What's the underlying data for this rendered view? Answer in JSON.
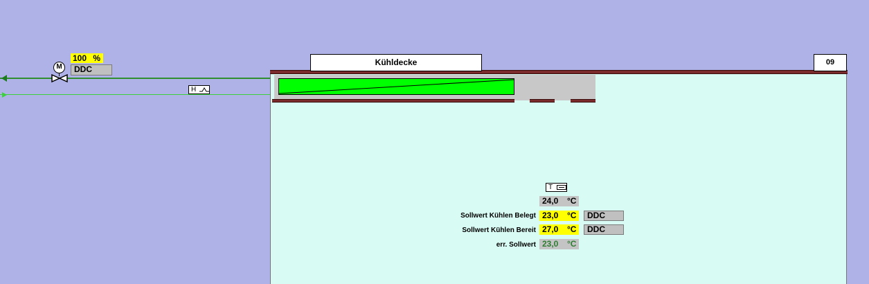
{
  "valve": {
    "motor_label": "M",
    "position": "100",
    "position_unit": "%",
    "mode": "DDC"
  },
  "heat_exchanger_tag": "H",
  "room": {
    "title": "Kühldecke",
    "number": "09"
  },
  "sensor": {
    "tag": "T",
    "temperature": "24,0",
    "unit": "°C"
  },
  "setpoints": [
    {
      "label": "Sollwert Kühlen Belegt",
      "value": "23,0",
      "unit": "°C",
      "mode": "DDC"
    },
    {
      "label": "Sollwert Kühlen Bereit",
      "value": "27,0",
      "unit": "°C",
      "mode": "DDC"
    }
  ],
  "effective_setpoint": {
    "label": "err. Sollwert",
    "value": "23,0",
    "unit": "°C"
  },
  "colors": {
    "background": "#aeb2e6",
    "room_fill": "#d8fbf3",
    "ceiling_brown": "#7b2b2b",
    "cooling_panel_green": "#00ff00",
    "value_yellow": "#ffff00",
    "value_gray": "#c4c4c4",
    "supply_pipe": "#2f8f2f",
    "return_pipe": "#3ad13a"
  }
}
